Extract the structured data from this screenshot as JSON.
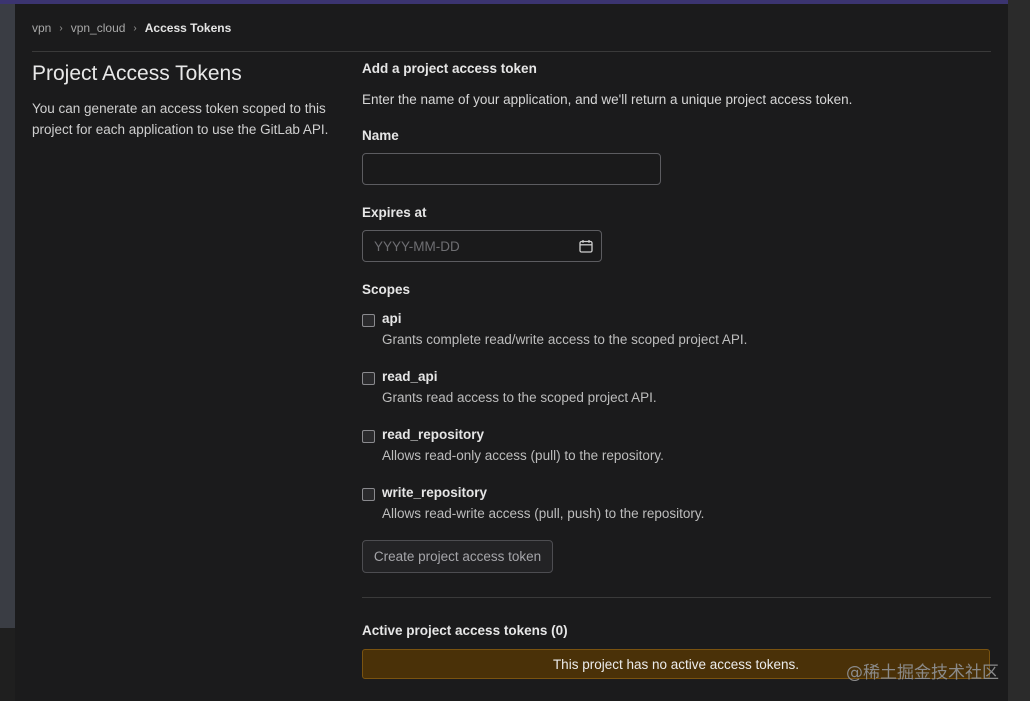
{
  "breadcrumb": {
    "items": [
      "vpn",
      "vpn_cloud"
    ],
    "current": "Access Tokens",
    "separator": "›"
  },
  "page": {
    "title": "Project Access Tokens",
    "description": "You can generate an access token scoped to this project for each application to use the GitLab API."
  },
  "form": {
    "title": "Add a project access token",
    "description": "Enter the name of your application, and we'll return a unique project access token.",
    "name_label": "Name",
    "name_value": "",
    "expires_label": "Expires at",
    "expires_placeholder": "YYYY-MM-DD",
    "scopes_label": "Scopes",
    "scopes": [
      {
        "name": "api",
        "description": "Grants complete read/write access to the scoped project API.",
        "checked": false
      },
      {
        "name": "read_api",
        "description": "Grants read access to the scoped project API.",
        "checked": false
      },
      {
        "name": "read_repository",
        "description": "Allows read-only access (pull) to the repository.",
        "checked": false
      },
      {
        "name": "write_repository",
        "description": "Allows read-write access (pull, push) to the repository.",
        "checked": false
      }
    ],
    "submit_label": "Create project access token"
  },
  "active_tokens": {
    "title": "Active project access tokens (0)",
    "empty_message": "This project has no active access tokens."
  },
  "watermark": "@稀土掘金技术社区",
  "colors": {
    "background": "#1b1b1c",
    "accent_bar": "#3b3470",
    "alert_bg": "#4a3108",
    "alert_border": "#7a5310"
  }
}
